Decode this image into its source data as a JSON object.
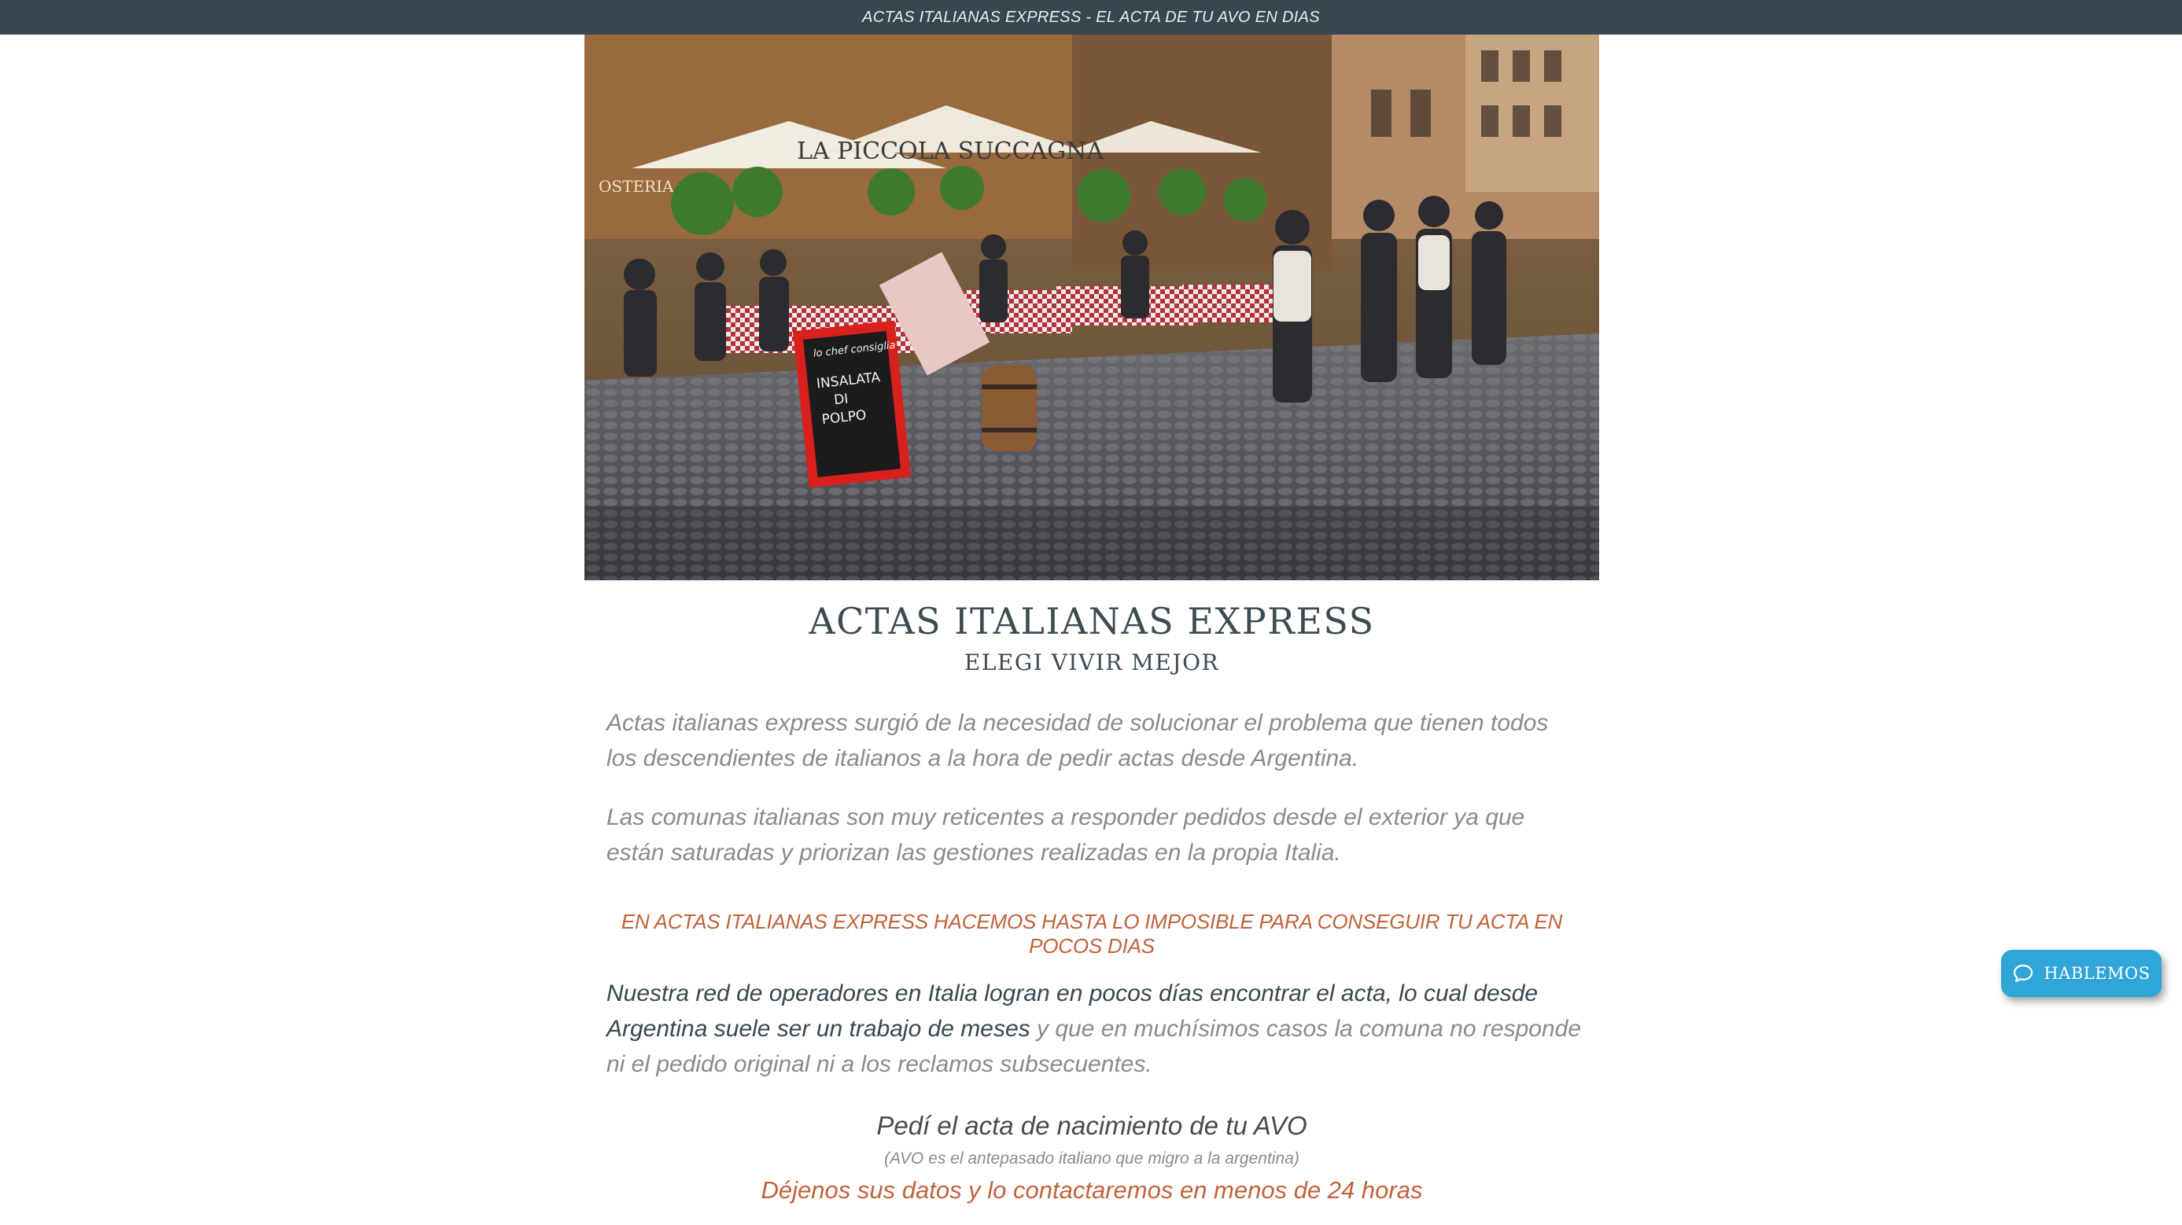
{
  "topbar": {
    "text": "ACTAS ITALIANAS EXPRESS - EL ACTA DE TU AVO EN DIAS"
  },
  "hero": {
    "signs": {
      "restaurant": "LA PICCOLA SUCCAGNA",
      "osteria": "OSTERIA",
      "chalkboard_top": "lo chef consiglia",
      "chalkboard_line1": "INSALATA",
      "chalkboard_line2": "DI",
      "chalkboard_line3": "POLPO"
    }
  },
  "main": {
    "title": "ACTAS ITALIANAS EXPRESS",
    "subtitle": "ELEGI VIVIR MEJOR",
    "paragraph1": "Actas italianas express surgió de la necesidad de solucionar el problema que tienen todos los descendientes de italianos a la hora de pedir actas desde Argentina.",
    "paragraph2": "Las comunas italianas son muy reticentes a responder pedidos desde el exterior ya que están saturadas y priorizan las gestiones realizadas en la propia Italia.",
    "highlight": "EN ACTAS ITALIANAS EXPRESS HACEMOS HASTA LO IMPOSIBLE PARA CONSEGUIR TU ACTA EN POCOS DIAS",
    "paragraph3_strong": "Nuestra red de operadores en Italia logran en pocos días encontrar el acta, lo cual desde Argentina suele ser un trabajo de meses",
    "paragraph3_rest": " y que en muchísimos casos la comuna no responde ni el pedido original ni a los reclamos subsecuentes.",
    "cta_title": "Pedí el acta de nacimiento de tu AVO",
    "cta_note": "(AVO es el antepasado italiano que migro a la argentina)",
    "cta_callout": "Déjenos sus datos y lo contactaremos en menos de 24 horas"
  },
  "chat": {
    "label": "HABLEMOS",
    "icon": "chat-bubble-icon",
    "color": "#2fa5d8"
  },
  "colors": {
    "topbar": "#37474f",
    "accent": "#c0623a",
    "heading": "#3c4b52"
  }
}
